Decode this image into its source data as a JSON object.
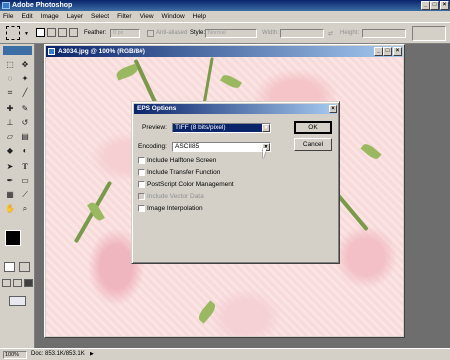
{
  "app": {
    "title": "Adobe Photoshop"
  },
  "window_buttons": {
    "minimize": "_",
    "maximize": "□",
    "close": "×"
  },
  "menu": [
    "File",
    "Edit",
    "Image",
    "Layer",
    "Select",
    "Filter",
    "View",
    "Window",
    "Help"
  ],
  "options_bar": {
    "feather_label": "Feather:",
    "feather_value": "0 px",
    "antialiased_label": "Anti-aliased",
    "style_label": "Style:",
    "style_value": "Normal",
    "width_label": "Width:",
    "height_label": "Height:"
  },
  "document": {
    "title": "A3034.jpg @ 100% (RGB/8#)"
  },
  "dialog": {
    "title": "EPS Options",
    "preview_label": "Preview:",
    "preview_value": "TIFF  (8 bits/pixel)",
    "encoding_label": "Encoding:",
    "encoding_value": "ASCII85",
    "ok_label": "OK",
    "cancel_label": "Cancel",
    "checkboxes": [
      {
        "label": "Include Halftone Screen",
        "checked": false,
        "enabled": true
      },
      {
        "label": "Include Transfer Function",
        "checked": false,
        "enabled": true
      },
      {
        "label": "PostScript Color Management",
        "checked": false,
        "enabled": true
      },
      {
        "label": "Include Vector Data",
        "checked": false,
        "enabled": false
      },
      {
        "label": "Image Interpolation",
        "checked": false,
        "enabled": true
      }
    ]
  },
  "status": {
    "zoom": "100%",
    "doc": "Doc: 853.1K/853.1K"
  },
  "colors": {
    "titlebar": "#0a246a",
    "chrome": "#d4d0c8",
    "preview_highlight": "#0a246a"
  }
}
